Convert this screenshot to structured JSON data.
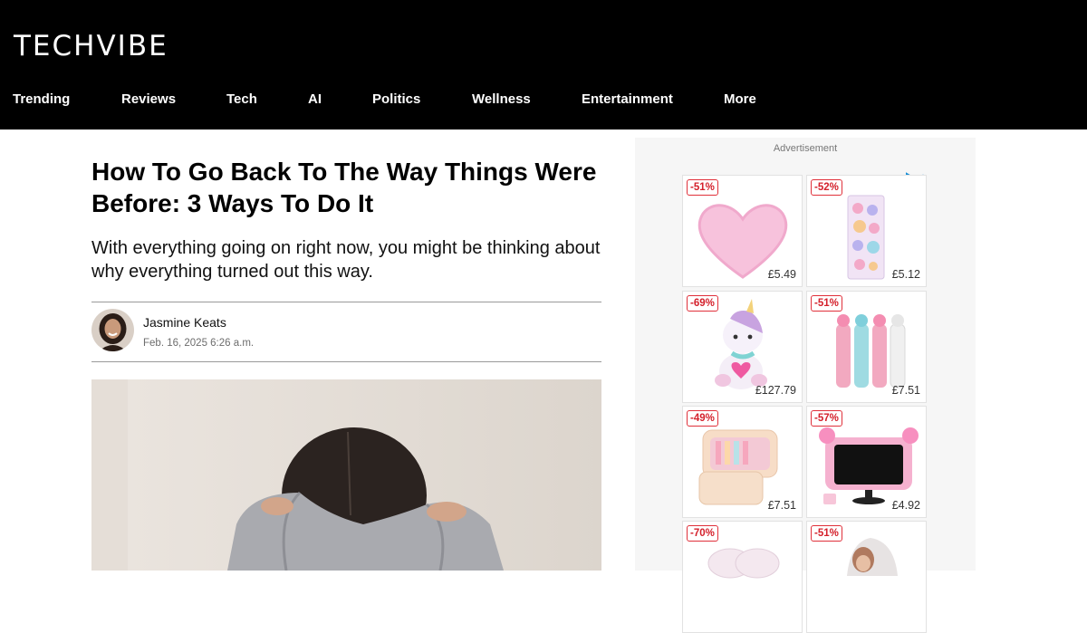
{
  "header": {
    "logo": "TECHVIBE",
    "nav": [
      {
        "label": "Trending"
      },
      {
        "label": "Reviews"
      },
      {
        "label": "Tech"
      },
      {
        "label": "AI"
      },
      {
        "label": "Politics"
      },
      {
        "label": "Wellness"
      },
      {
        "label": "Entertainment"
      },
      {
        "label": "More"
      }
    ]
  },
  "article": {
    "headline": "How To Go Back To The Way Things Were Before: 3 Ways To Do It",
    "subtitle": "With everything going on right now, you might be thinking about why everything turned out this way.",
    "author": "Jasmine Keats",
    "date": "Feb. 16, 2025 6:26 a.m."
  },
  "ad": {
    "label": "Advertisement",
    "products": [
      {
        "discount": "-51%",
        "price": "£5.49",
        "icon": "pink-heart-rug"
      },
      {
        "discount": "-52%",
        "price": "£5.12",
        "icon": "sticker-sheet"
      },
      {
        "discount": "-69%",
        "price": "£127.79",
        "icon": "unicorn-plush"
      },
      {
        "discount": "-51%",
        "price": "£7.51",
        "icon": "pen-set"
      },
      {
        "discount": "-49%",
        "price": "£7.51",
        "icon": "pencil-case"
      },
      {
        "discount": "-57%",
        "price": "£4.92",
        "icon": "pink-monitor"
      },
      {
        "discount": "-70%",
        "price": "",
        "icon": "fairy-wings"
      },
      {
        "discount": "-51%",
        "price": "",
        "icon": "bridal-veil"
      }
    ]
  },
  "colors": {
    "header_bg": "#000000",
    "badge_red": "#d4202b",
    "ad_bg": "#f6f6f6"
  }
}
